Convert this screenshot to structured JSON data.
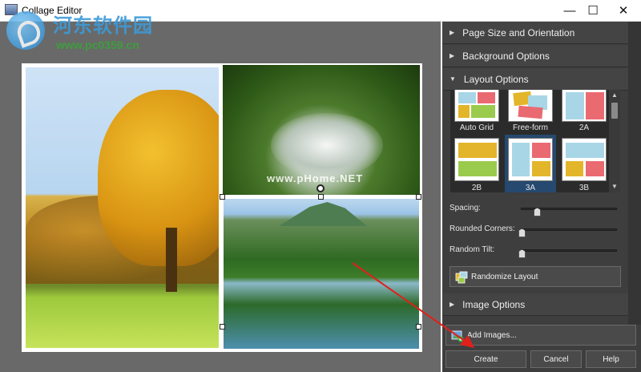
{
  "window": {
    "title": "Collage Editor",
    "controls": {
      "minimize": "—",
      "maximize": "☐",
      "close": "✕"
    }
  },
  "watermark": {
    "site_name": "河东软件园",
    "url": "www.pc0359.cn",
    "image_overlay": "www.pHome.NET"
  },
  "panel": {
    "sections": [
      {
        "label": "Page Size and Orientation",
        "expanded": false
      },
      {
        "label": "Background Options",
        "expanded": false
      },
      {
        "label": "Layout Options",
        "expanded": true
      },
      {
        "label": "Image Options",
        "expanded": false
      }
    ],
    "layouts": [
      {
        "label": "Auto Grid",
        "selected": false
      },
      {
        "label": "Free-form",
        "selected": false
      },
      {
        "label": "2A",
        "selected": false
      },
      {
        "label": "2B",
        "selected": false
      },
      {
        "label": "3A",
        "selected": true
      },
      {
        "label": "3B",
        "selected": false
      }
    ],
    "sliders": [
      {
        "label": "Spacing:",
        "value": 0.17
      },
      {
        "label": "Rounded Corners:",
        "value": 0.0
      },
      {
        "label": "Random Tilt:",
        "value": 0.0
      }
    ],
    "randomize_label": "Randomize Layout"
  },
  "footer": {
    "add_images_label": "Add Images...",
    "create_label": "Create",
    "cancel_label": "Cancel",
    "help_label": "Help"
  },
  "colors": {
    "panel_bg": "#3e3e3e",
    "canvas_bg": "#696969",
    "layout_yellow": "#e3b52a",
    "layout_red": "#ea6a72",
    "layout_blue": "#a8d6e6",
    "layout_green": "#9acb4d",
    "selection": "#25496f",
    "annotation_arrow": "#e0201a"
  }
}
